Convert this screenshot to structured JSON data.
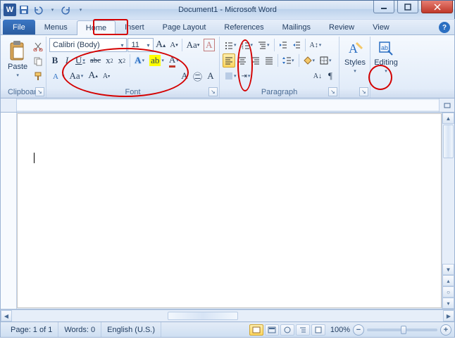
{
  "title": "Document1 - Microsoft Word",
  "qat": {
    "save": "save-icon",
    "undo": "undo-icon",
    "redo": "redo-icon"
  },
  "tabs": {
    "file": "File",
    "items": [
      "Menus",
      "Home",
      "Insert",
      "Page Layout",
      "References",
      "Mailings",
      "Review",
      "View"
    ],
    "active_index": 1
  },
  "ribbon": {
    "clipboard": {
      "label": "Clipboard",
      "paste": "Paste"
    },
    "font": {
      "label": "Font",
      "name": "Calibri (Body)",
      "size": "11",
      "bold": "B",
      "italic": "I",
      "underline": "U",
      "strike": "abc",
      "sub": "x",
      "sup": "x"
    },
    "paragraph": {
      "label": "Paragraph"
    },
    "styles": {
      "label": "Styles",
      "btn": "Styles"
    },
    "editing": {
      "label": "Editing",
      "btn": "Editing"
    }
  },
  "status": {
    "page": "Page: 1 of 1",
    "words": "Words: 0",
    "lang": "English (U.S.)",
    "zoom": "100%"
  }
}
